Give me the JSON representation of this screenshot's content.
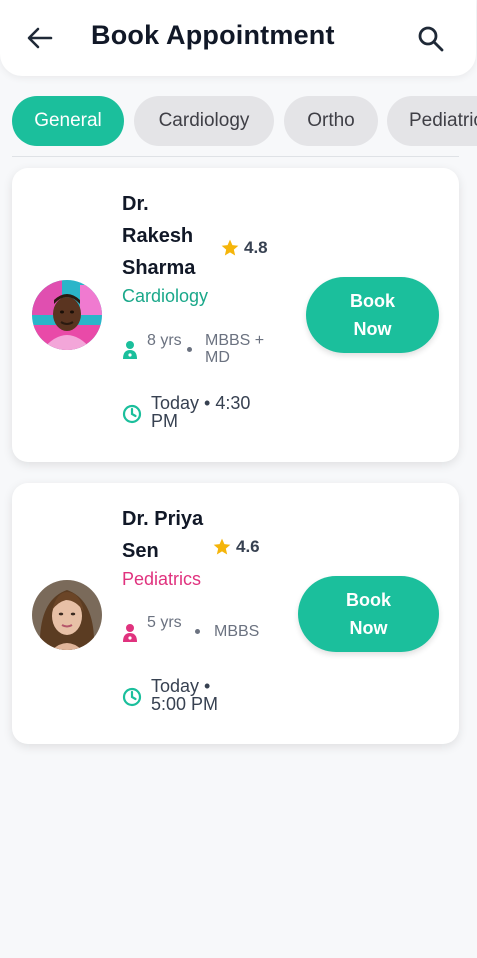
{
  "header": {
    "title": "Book Appointment",
    "back_icon": "arrow-left-icon",
    "search_icon": "search-icon"
  },
  "chips": [
    {
      "label": "General",
      "active": true
    },
    {
      "label": "Cardiology",
      "active": false
    },
    {
      "label": "Ortho",
      "active": false
    },
    {
      "label": "Pediatrics",
      "active": false
    }
  ],
  "doctors": [
    {
      "name": "Dr. Rakesh Sharma",
      "rating": "4.8",
      "specialty": "Cardiology",
      "experience": "8 yrs",
      "degree": "MBBS + MD",
      "availability": "Today • 4:30 PM",
      "button": "Book Now"
    },
    {
      "name": "Dr. Priya Sen",
      "rating": "4.6",
      "specialty": "Pediatrics",
      "experience": "5 yrs",
      "degree": "MBBS",
      "availability": "Today • 5:00 PM",
      "button": "Book Now"
    }
  ],
  "colors": {
    "accent": "#1bbf9c",
    "cardiology": "#1aa88a",
    "pediatrics": "#e0327e",
    "star": "#f5b50a"
  }
}
